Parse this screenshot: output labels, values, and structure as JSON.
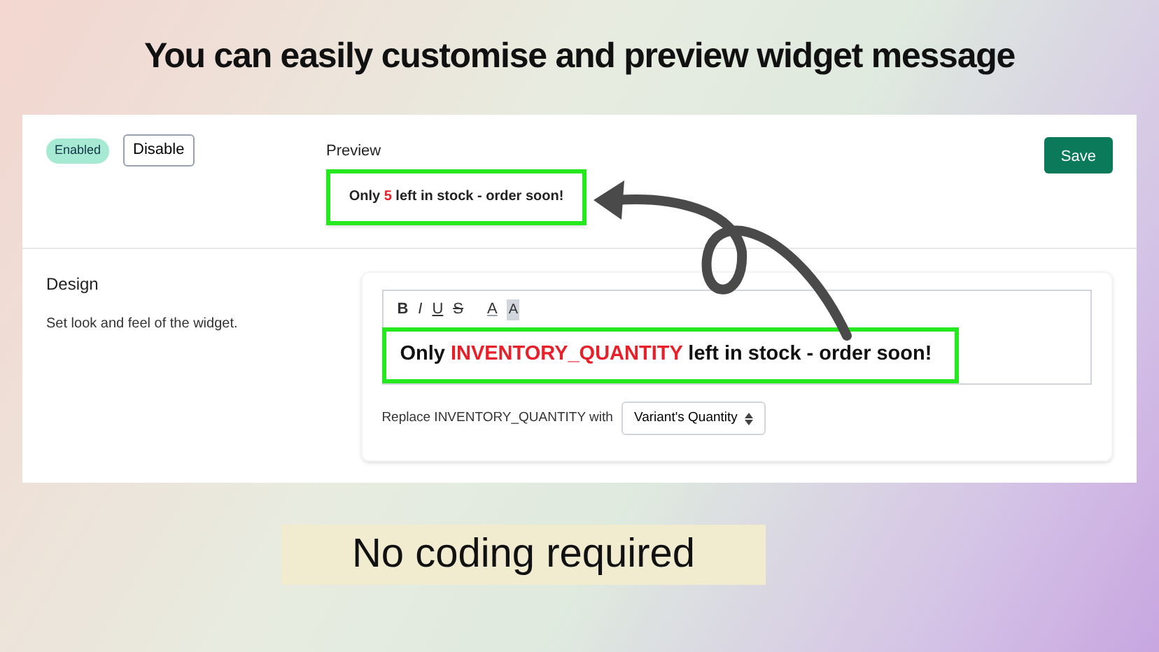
{
  "headline": "You can easily customise and preview widget message",
  "status": {
    "badge": "Enabled",
    "enabled": true,
    "toggle_button": "Disable"
  },
  "preview": {
    "label": "Preview",
    "parts": [
      {
        "text": "Only ",
        "kind": "plain"
      },
      {
        "text": "5",
        "kind": "variable"
      },
      {
        "text": " left in stock - order soon!",
        "kind": "plain"
      }
    ]
  },
  "save_button": "Save",
  "design": {
    "title": "Design",
    "description": "Set look and feel of the widget.",
    "toolbar": [
      {
        "glyph": "B",
        "kind": "bold"
      },
      {
        "glyph": "I",
        "kind": "italic"
      },
      {
        "glyph": "U",
        "kind": "underline"
      },
      {
        "glyph": "S",
        "kind": "strike"
      },
      {
        "glyph": "A",
        "kind": "text-color"
      },
      {
        "glyph": "A",
        "kind": "highlight"
      }
    ],
    "editor_parts": [
      {
        "text": "Only ",
        "kind": "plain"
      },
      {
        "text": "INVENTORY_QUANTITY",
        "kind": "variable"
      },
      {
        "text": " left in stock - order soon!",
        "kind": "plain"
      }
    ],
    "replace_label": "Replace INVENTORY_QUANTITY with",
    "replace_value": "Variant's Quantity"
  },
  "banner": "No coding required"
}
